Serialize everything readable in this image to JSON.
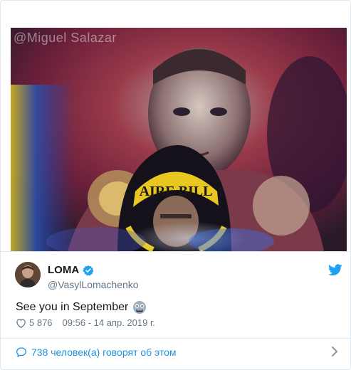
{
  "media": {
    "watermark": "@Miguel Salazar",
    "hood_text": "AIRE BILL"
  },
  "tweet": {
    "display_name": "LOMA",
    "handle": "@VasylLomachenko",
    "text": "See you in September",
    "likes": "5 876",
    "timestamp": "09:56 - 14 апр. 2019 г."
  },
  "footer": {
    "label": "738 человек(а) говорят об этом"
  },
  "colors": {
    "brand": "#1da1f2",
    "link": "#1b95e0",
    "muted": "#657786",
    "text": "#14171a",
    "border": "#e1e8ed"
  },
  "icons": {
    "verified": "verified-badge-icon",
    "bird": "twitter-bird-icon",
    "heart": "heart-outline-icon",
    "bubble": "speech-bubble-icon",
    "chevron": "chevron-right-icon",
    "emoji": "astonished-face-emoji"
  }
}
